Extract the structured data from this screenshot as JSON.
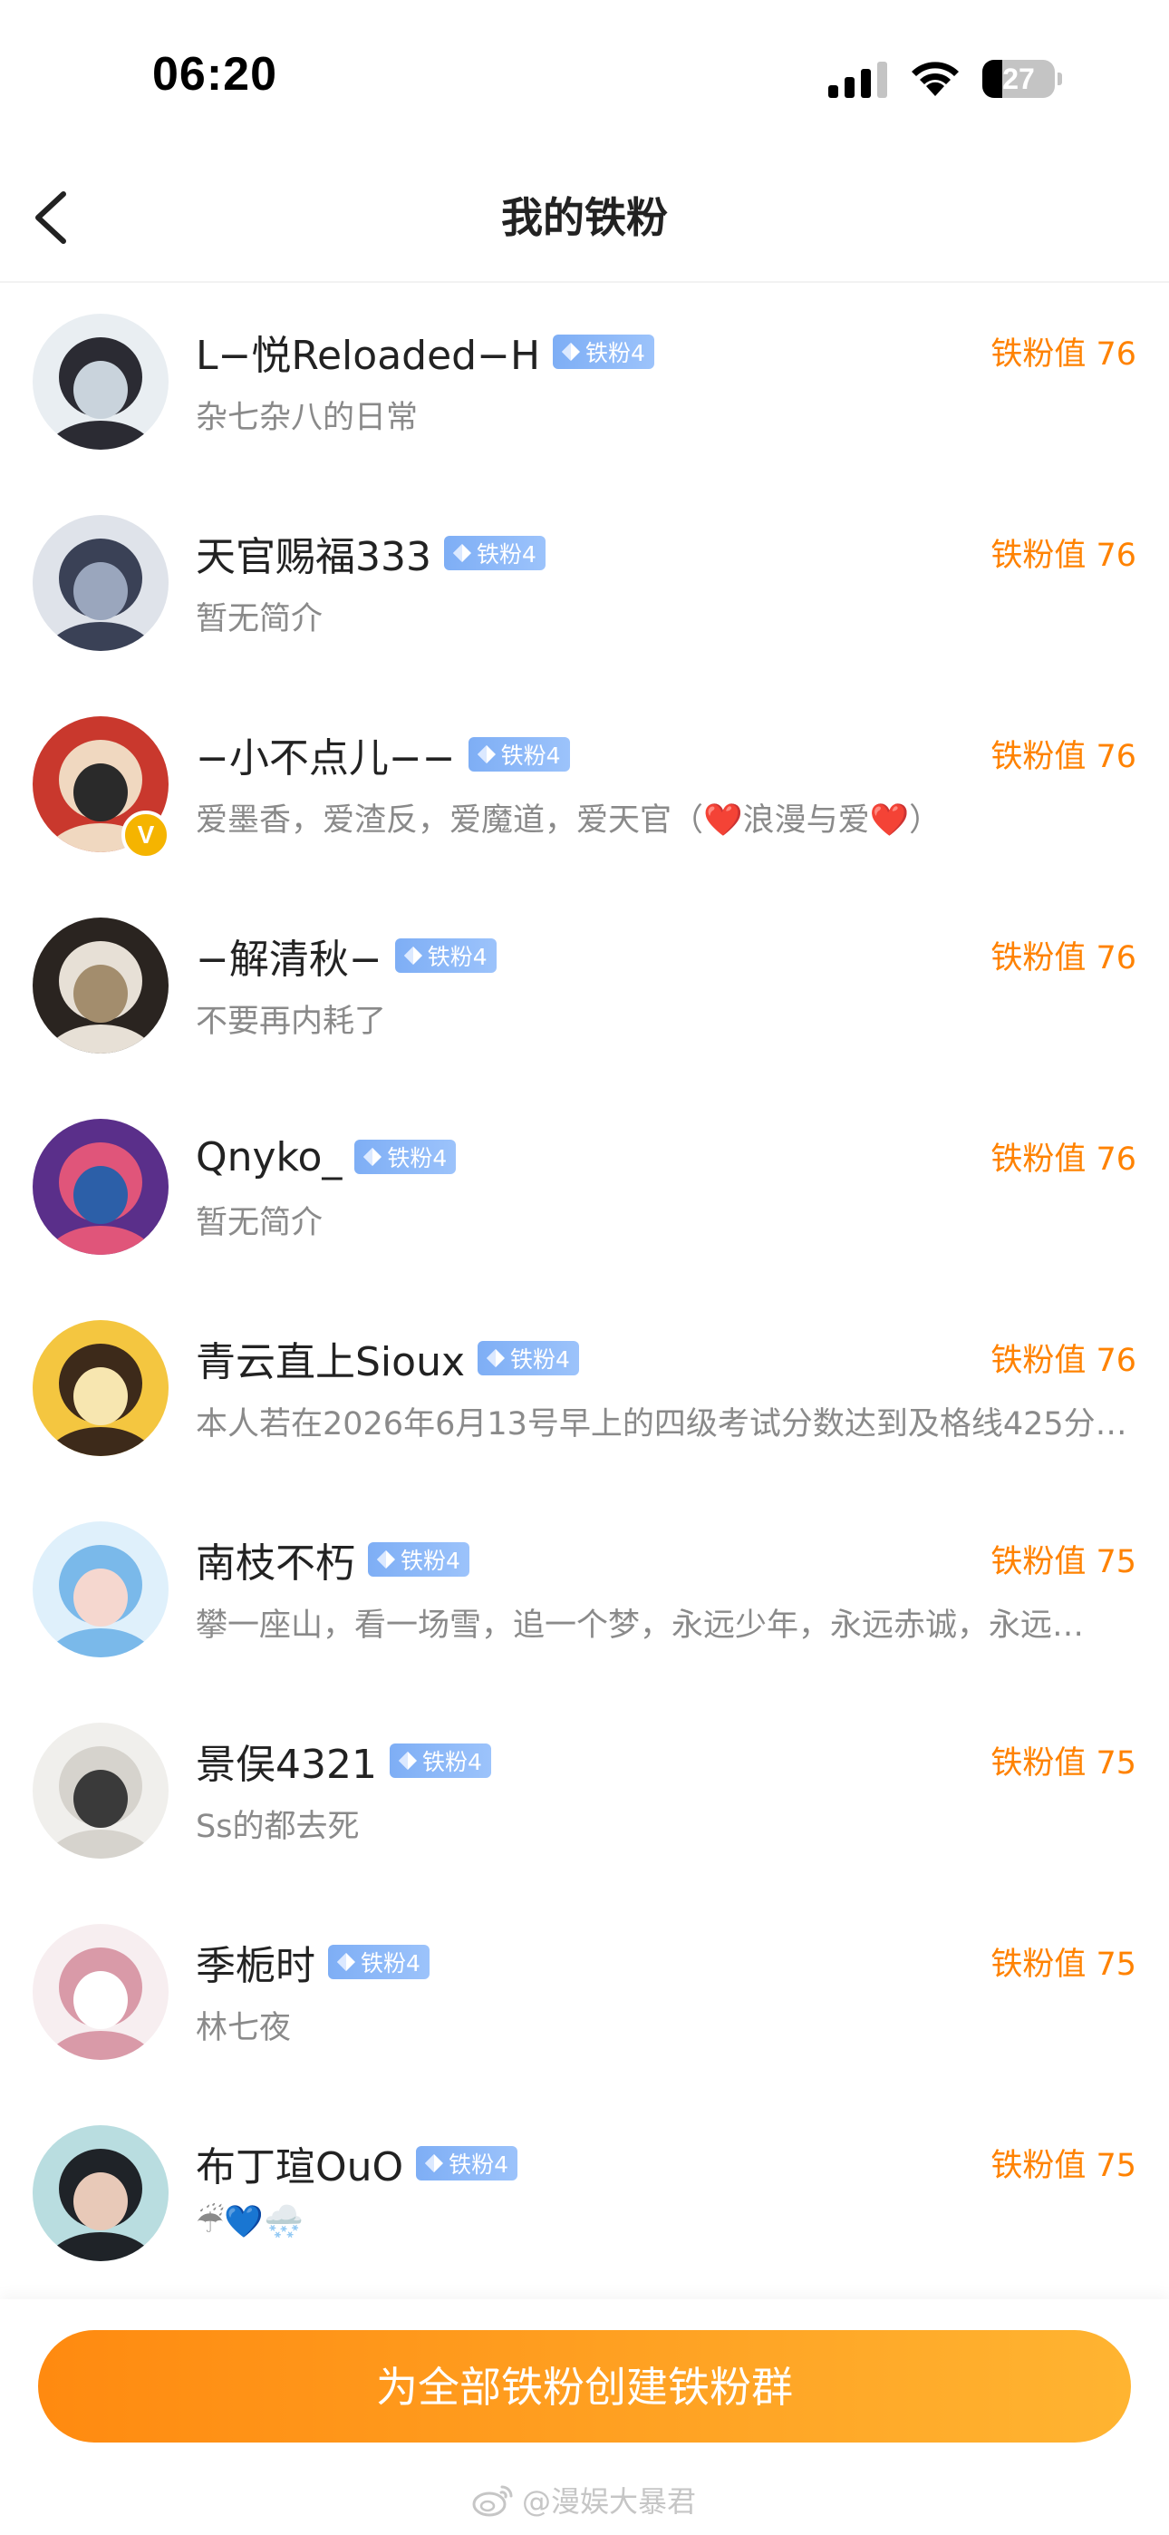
{
  "status_bar": {
    "time": "06:20",
    "battery_level": "27",
    "battery_fraction": 0.27
  },
  "nav": {
    "title": "我的铁粉",
    "back_icon": "chevron-left-icon"
  },
  "fans": [
    {
      "name": "L−悦Reloaded−H",
      "badge": "铁粉4",
      "bio": "杂七杂八的日常",
      "score": "铁粉值 76",
      "verified": false
    },
    {
      "name": "天官赐福333",
      "badge": "铁粉4",
      "bio": "暂无简介",
      "score": "铁粉值 76",
      "verified": false
    },
    {
      "name": "−小不点儿−−",
      "badge": "铁粉4",
      "bio": "爱墨香，爱渣反，爱魔道，爱天官（❤️浪漫与爱❤️）",
      "score": "铁粉值 76",
      "verified": true,
      "verified_mark": "V"
    },
    {
      "name": "−解清秋−",
      "badge": "铁粉4",
      "bio": "不要再内耗了",
      "score": "铁粉值 76",
      "verified": false
    },
    {
      "name": "Qnyko_",
      "badge": "铁粉4",
      "bio": "暂无简介",
      "score": "铁粉值 76",
      "verified": false
    },
    {
      "name": "青云直上Sioux",
      "badge": "铁粉4",
      "bio": "本人若在2026年6月13号早上的四级考试分数达到及格线425分…",
      "score": "铁粉值 76",
      "verified": false
    },
    {
      "name": "南枝不朽",
      "badge": "铁粉4",
      "bio": "攀一座山，看一场雪，追一个梦，永远少年，永远赤诚，永远…",
      "score": "铁粉值 75",
      "verified": false
    },
    {
      "name": "景俣4321",
      "badge": "铁粉4",
      "bio": "Ss的都去死",
      "score": "铁粉值 75",
      "verified": false
    },
    {
      "name": "季栀时",
      "badge": "铁粉4",
      "bio": "林七夜",
      "score": "铁粉值 75",
      "verified": false
    },
    {
      "name": "布丁瑄OuO",
      "badge": "铁粉4",
      "bio": "☔💙🌨️",
      "score": "铁粉值 75",
      "verified": false
    }
  ],
  "avatar_palettes": [
    [
      "#e9eef2",
      "#2b2b33",
      "#c9d3dc"
    ],
    [
      "#dfe3ea",
      "#3a4156",
      "#9aa6bd"
    ],
    [
      "#c9382d",
      "#f0d8c0",
      "#2a2a2a"
    ],
    [
      "#2a2420",
      "#e7e0d6",
      "#a38d6d"
    ],
    [
      "#5a2f8a",
      "#e0557a",
      "#2c5fa8"
    ],
    [
      "#f4c640",
      "#3d2a1a",
      "#f7e6b0"
    ],
    [
      "#dff0fb",
      "#7ab9ea",
      "#f5d7cf"
    ],
    [
      "#f0efec",
      "#d6d3cd",
      "#3a3a3a"
    ],
    [
      "#f7eef0",
      "#d99aa8",
      "#ffffff"
    ],
    [
      "#b9dde0",
      "#1f2328",
      "#e8c9b8"
    ]
  ],
  "bottom": {
    "create_group_label": "为全部铁粉创建铁粉群",
    "watermark": "@漫娱大暴君"
  },
  "colors": {
    "accent_orange": "#ff8200",
    "badge_blue": "#8bb8f8",
    "bio_gray": "#8a8a8a"
  }
}
